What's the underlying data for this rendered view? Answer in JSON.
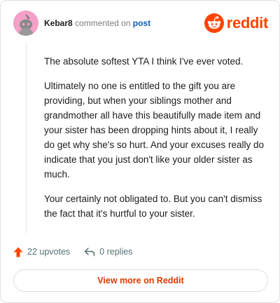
{
  "header": {
    "author": "Kebar8",
    "action_text": "commented on",
    "post_link": "post",
    "brand": "reddit"
  },
  "comment": {
    "paragraphs": [
      "The absolute softest YTA I think I've ever voted.",
      "Ultimately no one is entitled to the gift you are providing, but when your siblings mother and grandmother all have this beautifully made item and your sister has been dropping hints about it, I really do get why she's so hurt. And your excuses really do indicate that you just don't like your older sister as much.",
      "Your certainly not obligated to. But you can't dismiss the fact that it's hurtful to your sister."
    ]
  },
  "actions": {
    "upvotes": "22 upvotes",
    "replies": "0 replies"
  },
  "footer": {
    "view_more": "View more on Reddit"
  },
  "colors": {
    "brand": "#ff4500",
    "link": "#0a5fbd",
    "cta": "#d93a00",
    "avatar_bg": "#f3a1c6"
  },
  "icons": [
    "avatar-snoo-icon",
    "reddit-logo-icon",
    "upvote-arrow-icon",
    "reply-arrow-icon"
  ]
}
